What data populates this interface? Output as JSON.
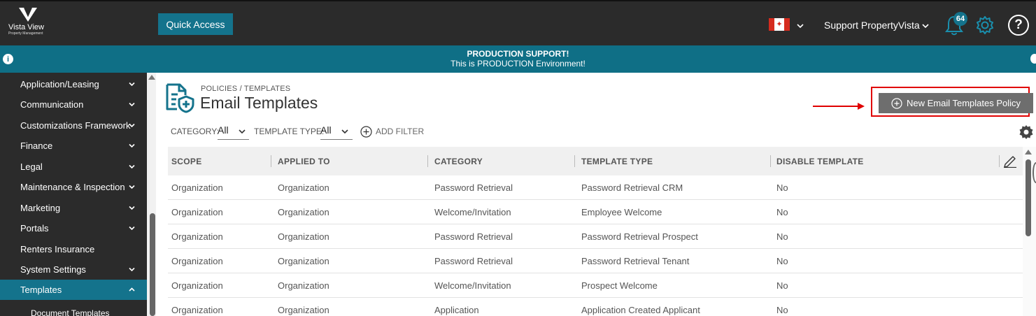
{
  "logo": {
    "brand": "Vista View",
    "sub": "Property Management"
  },
  "header": {
    "quick_access": "Quick Access",
    "flag_icon": "canada-flag-icon",
    "user_name": "Support PropertyVista",
    "notification_count": "64",
    "help_symbol": "?"
  },
  "banner": {
    "title": "PRODUCTION SUPPORT!",
    "message": "This is PRODUCTION Environment!",
    "info_symbol": "i"
  },
  "sidebar": {
    "items": [
      {
        "label": "Application/Leasing"
      },
      {
        "label": "Communication"
      },
      {
        "label": "Customizations Framework"
      },
      {
        "label": "Finance"
      },
      {
        "label": "Legal"
      },
      {
        "label": "Maintenance & Inspection"
      },
      {
        "label": "Marketing"
      },
      {
        "label": "Portals"
      },
      {
        "label": "Renters Insurance"
      },
      {
        "label": "System Settings"
      },
      {
        "label": "Templates"
      }
    ],
    "subitems": [
      {
        "label": "Document Templates"
      }
    ]
  },
  "page": {
    "breadcrumb": "POLICIES / TEMPLATES",
    "title": "Email Templates",
    "new_button": "New Email Templates Policy"
  },
  "filters": {
    "category_label": "CATEGORY:",
    "category_value": "All",
    "template_type_label": "TEMPLATE TYPE:",
    "template_type_value": "All",
    "add_filter": "ADD FILTER"
  },
  "table": {
    "columns": [
      "SCOPE",
      "APPLIED TO",
      "CATEGORY",
      "TEMPLATE TYPE",
      "DISABLE TEMPLATE"
    ],
    "rows": [
      [
        "Organization",
        "Organization",
        "Password Retrieval",
        "Password Retrieval CRM",
        "No"
      ],
      [
        "Organization",
        "Organization",
        "Welcome/Invitation",
        "Employee Welcome",
        "No"
      ],
      [
        "Organization",
        "Organization",
        "Password Retrieval",
        "Password Retrieval Prospect",
        "No"
      ],
      [
        "Organization",
        "Organization",
        "Password Retrieval",
        "Password Retrieval Tenant",
        "No"
      ],
      [
        "Organization",
        "Organization",
        "Welcome/Invitation",
        "Prospect Welcome",
        "No"
      ],
      [
        "Organization",
        "Organization",
        "Application",
        "Application Created Applicant",
        "No"
      ]
    ]
  },
  "colors": {
    "topbar": "#2b2b2b",
    "accent": "#14738c",
    "banner": "#0f6f86",
    "highlight": "#e00000",
    "button_gray": "#6e6e6e"
  }
}
